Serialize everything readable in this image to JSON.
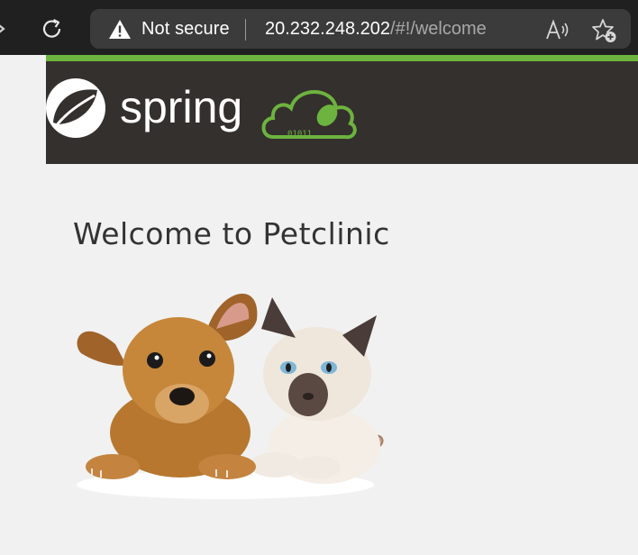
{
  "browser": {
    "security_label": "Not secure",
    "url_host": "20.232.248.202",
    "url_path": "/#!/welcome",
    "icons": [
      "reload-icon",
      "warning-icon",
      "read-aloud-icon",
      "add-favorite-icon"
    ]
  },
  "navbar": {
    "logo_alt": "spring",
    "logo_binary": "01011"
  },
  "main": {
    "title": "Welcome to Petclinic",
    "image": "pets-illustration"
  },
  "colors": {
    "spring_green": "#6db33f",
    "navbar_bg": "#34302d",
    "page_bg": "#f1f1f1",
    "title_text": "#333333"
  }
}
